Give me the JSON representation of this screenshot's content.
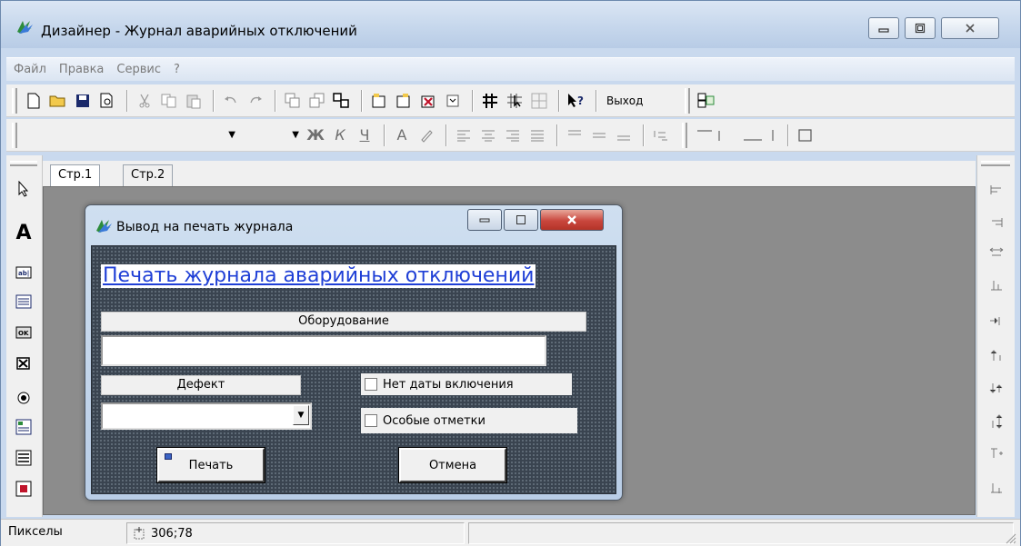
{
  "window": {
    "title": "Дизайнер - Журнал аварийных отключений"
  },
  "menu": [
    "Файл",
    "Правка",
    "Сервис",
    "?"
  ],
  "toolbar": {
    "exit_label": "Выход",
    "format_glyphs": [
      "Ж",
      "К",
      "Ч",
      "A"
    ]
  },
  "tabs": [
    "Стр.1",
    "Стр.2"
  ],
  "form": {
    "title": "Вывод на печать журнала",
    "link_text": "Печать журнала аварийных отключений",
    "equipment_label": "Оборудование",
    "defect_label": "Дефект",
    "no_date_label": "Нет даты включения",
    "special_marks_label": "Особые отметки",
    "print_button": "Печать",
    "cancel_button": "Отмена"
  },
  "toolbox_left": {
    "text_tool": "A"
  },
  "status": {
    "units": "Пикселы",
    "coords": "306;78"
  },
  "colors": {
    "link": "#1f3fd6",
    "canvas": "#8c8c8c",
    "form_client": "#3a4450",
    "close_button": "#c9463d"
  }
}
